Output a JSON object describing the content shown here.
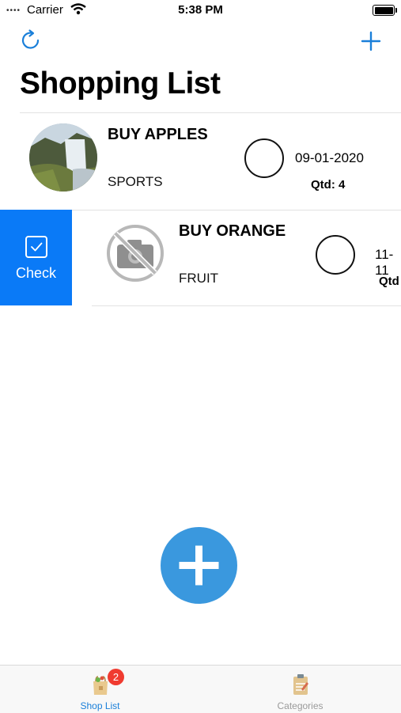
{
  "status_bar": {
    "carrier": "Carrier",
    "time": "5:38 PM"
  },
  "nav": {
    "title": "Shopping List",
    "refresh_icon": "refresh-icon",
    "add_icon": "plus-icon"
  },
  "items": [
    {
      "title": "BUY APPLES",
      "category": "SPORTS",
      "date": "09-01-2020",
      "qty": "Qtd: 4",
      "image": "landscape-photo"
    },
    {
      "title": "BUY ORANGE",
      "category": "FRUIT",
      "date": "11-11",
      "qty": "Qtd",
      "image": "no-photo-icon"
    }
  ],
  "swipe_action": {
    "label": "Check",
    "color": "#0a7af7"
  },
  "fab": {
    "icon": "plus-icon",
    "color": "#3a98de"
  },
  "tabbar": {
    "tabs": [
      {
        "label": "Shop List",
        "active": true,
        "color": "#1a7fd9"
      },
      {
        "label": "Categories",
        "active": false,
        "color": "#9a9a9a"
      }
    ],
    "badge": "2"
  }
}
